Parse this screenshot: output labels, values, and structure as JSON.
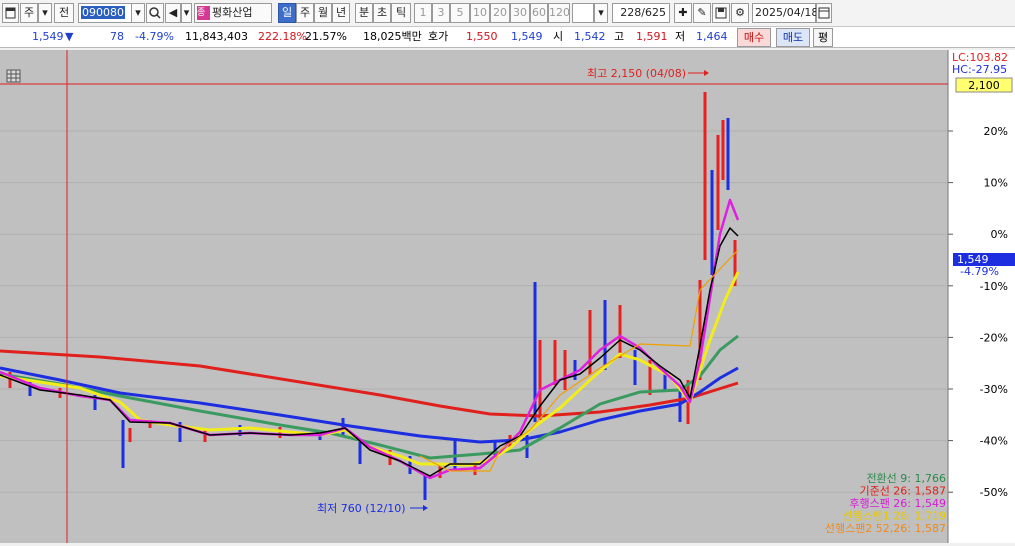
{
  "toolbar": {
    "type_label": "주",
    "mode_label": "전",
    "code_value": "090080",
    "stock_name": "평화산업",
    "stock_tag": "종",
    "periods": [
      "일",
      "주",
      "월",
      "년",
      "분",
      "초",
      "틱"
    ],
    "selected_period": "일",
    "intervals": [
      "1",
      "3",
      "5",
      "10",
      "20",
      "30",
      "60",
      "120"
    ],
    "count_value": "228/625",
    "date_value": "2025/04/18"
  },
  "quote": {
    "price": "1,549",
    "change_arrow": "▼",
    "change": "78",
    "change_pct": "-4.79%",
    "volume": "11,843,403",
    "volume_ratio": "222.18%",
    "turnover": "21.57%",
    "amount": "18,025백만",
    "bid_label": "호가",
    "ask_price": "1,550",
    "bid_price": "1,549",
    "open_label": "시",
    "open": "1,542",
    "high_label": "고",
    "high": "1,591",
    "low_label": "저",
    "low": "1,464",
    "buy_button": "매수",
    "sell_button": "매도",
    "avg_button": "평"
  },
  "chart": {
    "lc_label": "LC:103.82",
    "hc_label": "HC:-27.95",
    "high_price_tag": "2,100",
    "current_price_tag": "1,549",
    "current_pct_tag": "-4.79%",
    "high_annotation": "최고 2,150 (04/08)",
    "low_annotation": "최저 760 (12/10)",
    "y_ticks": [
      "20%",
      "10%",
      "0%",
      "-10%",
      "-20%",
      "-30%",
      "-40%",
      "-50%"
    ],
    "legend": [
      {
        "label": "전환선 9: 1,766",
        "color": "#2a8a4a"
      },
      {
        "label": "기준선 26: 1,587",
        "color": "#e0201c"
      },
      {
        "label": "후행스팬 26: 1,549",
        "color": "#d81ad8"
      },
      {
        "label": "선행스팬1 26: 1,719",
        "color": "#e8c800"
      },
      {
        "label": "선행스팬2 52,26: 1,587",
        "color": "#f08a1a"
      }
    ],
    "colors": {
      "background": "#c0c0c0",
      "red_line": "#e0201c",
      "blue_line": "#1c2ee0",
      "green_line": "#3a9a60",
      "yellow_line": "#f2ec1a",
      "magenta_line": "#e020e0",
      "black_line": "#000000",
      "orange_line": "#f0a000"
    }
  }
}
